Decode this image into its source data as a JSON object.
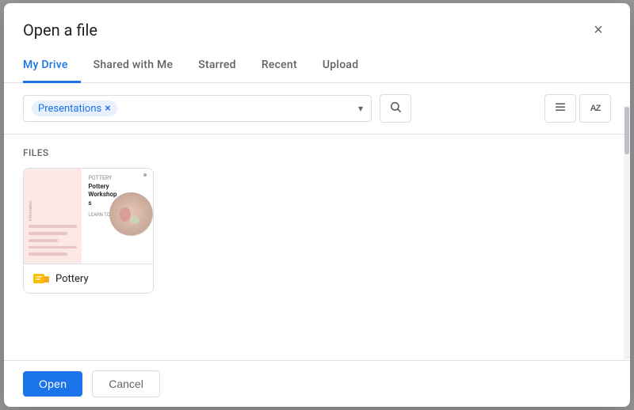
{
  "dialog": {
    "title": "Open a file",
    "close_label": "×"
  },
  "tabs": [
    {
      "id": "my-drive",
      "label": "My Drive",
      "active": true
    },
    {
      "id": "shared-with-me",
      "label": "Shared with Me",
      "active": false
    },
    {
      "id": "starred",
      "label": "Starred",
      "active": false
    },
    {
      "id": "recent",
      "label": "Recent",
      "active": false
    },
    {
      "id": "upload",
      "label": "Upload",
      "active": false
    }
  ],
  "toolbar": {
    "filter_chip_label": "Presentations",
    "chip_close": "×",
    "dropdown_arrow": "▾",
    "search_icon": "🔍",
    "list_view_icon": "☰",
    "sort_icon": "AZ"
  },
  "content": {
    "section_label": "Files",
    "files": [
      {
        "name": "Pottery",
        "preview_title": "Pottery Workshops",
        "preview_sub": "LEARN TOGETHER"
      }
    ]
  },
  "footer": {
    "open_label": "Open",
    "cancel_label": "Cancel"
  }
}
